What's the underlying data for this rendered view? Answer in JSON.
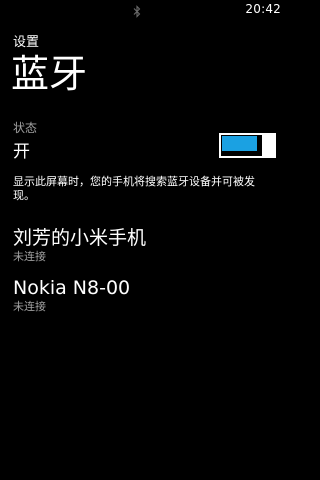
{
  "status_bar": {
    "time": "20:42",
    "bluetooth_icon": "bluetooth-icon"
  },
  "header": {
    "app_title": "设置",
    "page_title": "蓝牙"
  },
  "bluetooth": {
    "status_label": "状态",
    "status_value": "开",
    "toggle_on": true,
    "accent_color": "#1ba1e2"
  },
  "description": "显示此屏幕时，您的手机将搜索蓝牙设备并可被发现。",
  "devices": [
    {
      "name": "刘芳的小米手机",
      "status": "未连接"
    },
    {
      "name": "Nokia N8-00",
      "status": "未连接"
    }
  ]
}
